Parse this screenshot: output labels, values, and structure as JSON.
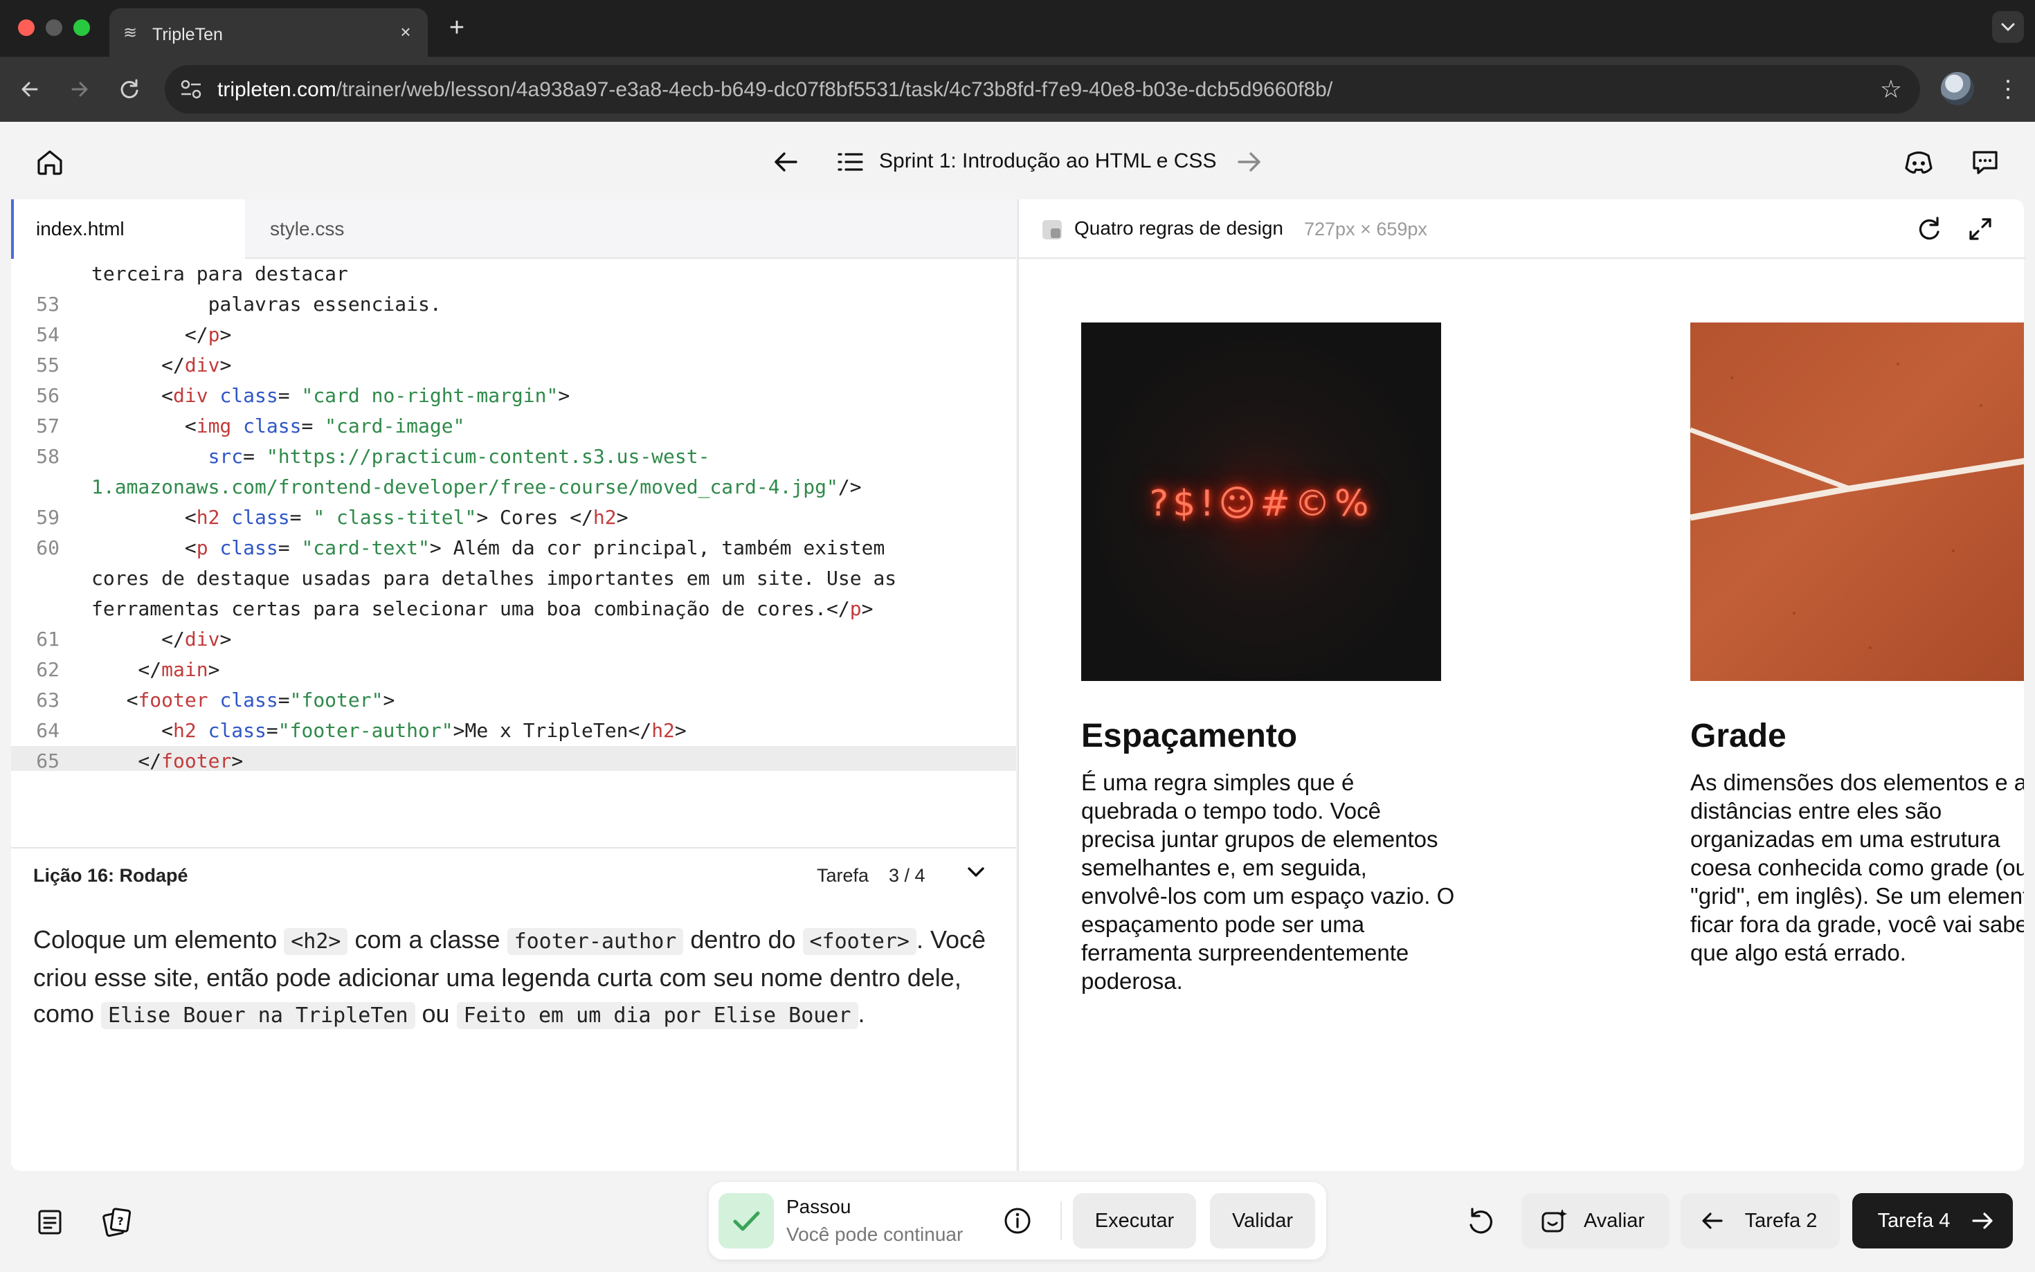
{
  "browser": {
    "tab_title": "TripleTen",
    "new_tab": "+",
    "close": "×",
    "url_host": "tripleten.com",
    "url_path": "/trainer/web/lesson/4a938a97-e3a8-4ecb-b649-dc07f8bf5531/task/4c73b8fd-f7e9-40e8-b03e-dcb5d9660f8b/",
    "colors": {
      "close": "#ff5f57",
      "min": "#febc2e",
      "max": "#28c840"
    }
  },
  "header": {
    "sprint_title": "Sprint 1: Introdução ao HTML e CSS"
  },
  "editor": {
    "tabs": [
      "index.html",
      "style.css"
    ],
    "active_tab": "index.html",
    "highlighted_line": "65"
  },
  "lesson": {
    "title": "Lição 16: Rodapé",
    "task_label": "Tarefa",
    "task_progress": "3 / 4",
    "instruction": {
      "t1": "Coloque um elemento ",
      "c1": "<h2>",
      "t2": " com a classe ",
      "c2": "footer-author",
      "t3": " dentro do ",
      "c3": " <footer>",
      "t4": ". Você criou esse site, então pode adicionar uma legenda curta com seu nome dentro dele, como ",
      "c4": "Elise Bouer na TripleTen",
      "t5": " ou ",
      "c5": "Feito em um dia por Elise Bouer",
      "t6": "."
    }
  },
  "preview": {
    "title": "Quatro regras de design",
    "size": "727px × 659px",
    "neon_text": "?$!☺#©%",
    "cards": [
      {
        "title": "Espaçamento",
        "text": "É uma regra simples que é quebrada o tempo todo. Você precisa juntar grupos de elementos semelhantes e, em seguida, envolvê-los com um espaço vazio. O espaçamento pode ser uma ferramenta surpreendentemente poderosa."
      },
      {
        "title": "Grade",
        "text": "As dimensões dos elementos e as distâncias entre eles são organizadas em uma estrutura coesa conhecida como grade (ou \"grid\", em inglês). Se um elemento ficar fora da grade, você vai saber que algo está errado."
      }
    ]
  },
  "bottom": {
    "status_title": "Passou",
    "status_subtitle": "Você pode continuar",
    "run": "Executar",
    "validate": "Validar",
    "review": "Avaliar",
    "prev_task": "Tarefa 2",
    "next_task": "Tarefa 4",
    "accent": "#1c1c1c",
    "success": "#4caf67"
  }
}
